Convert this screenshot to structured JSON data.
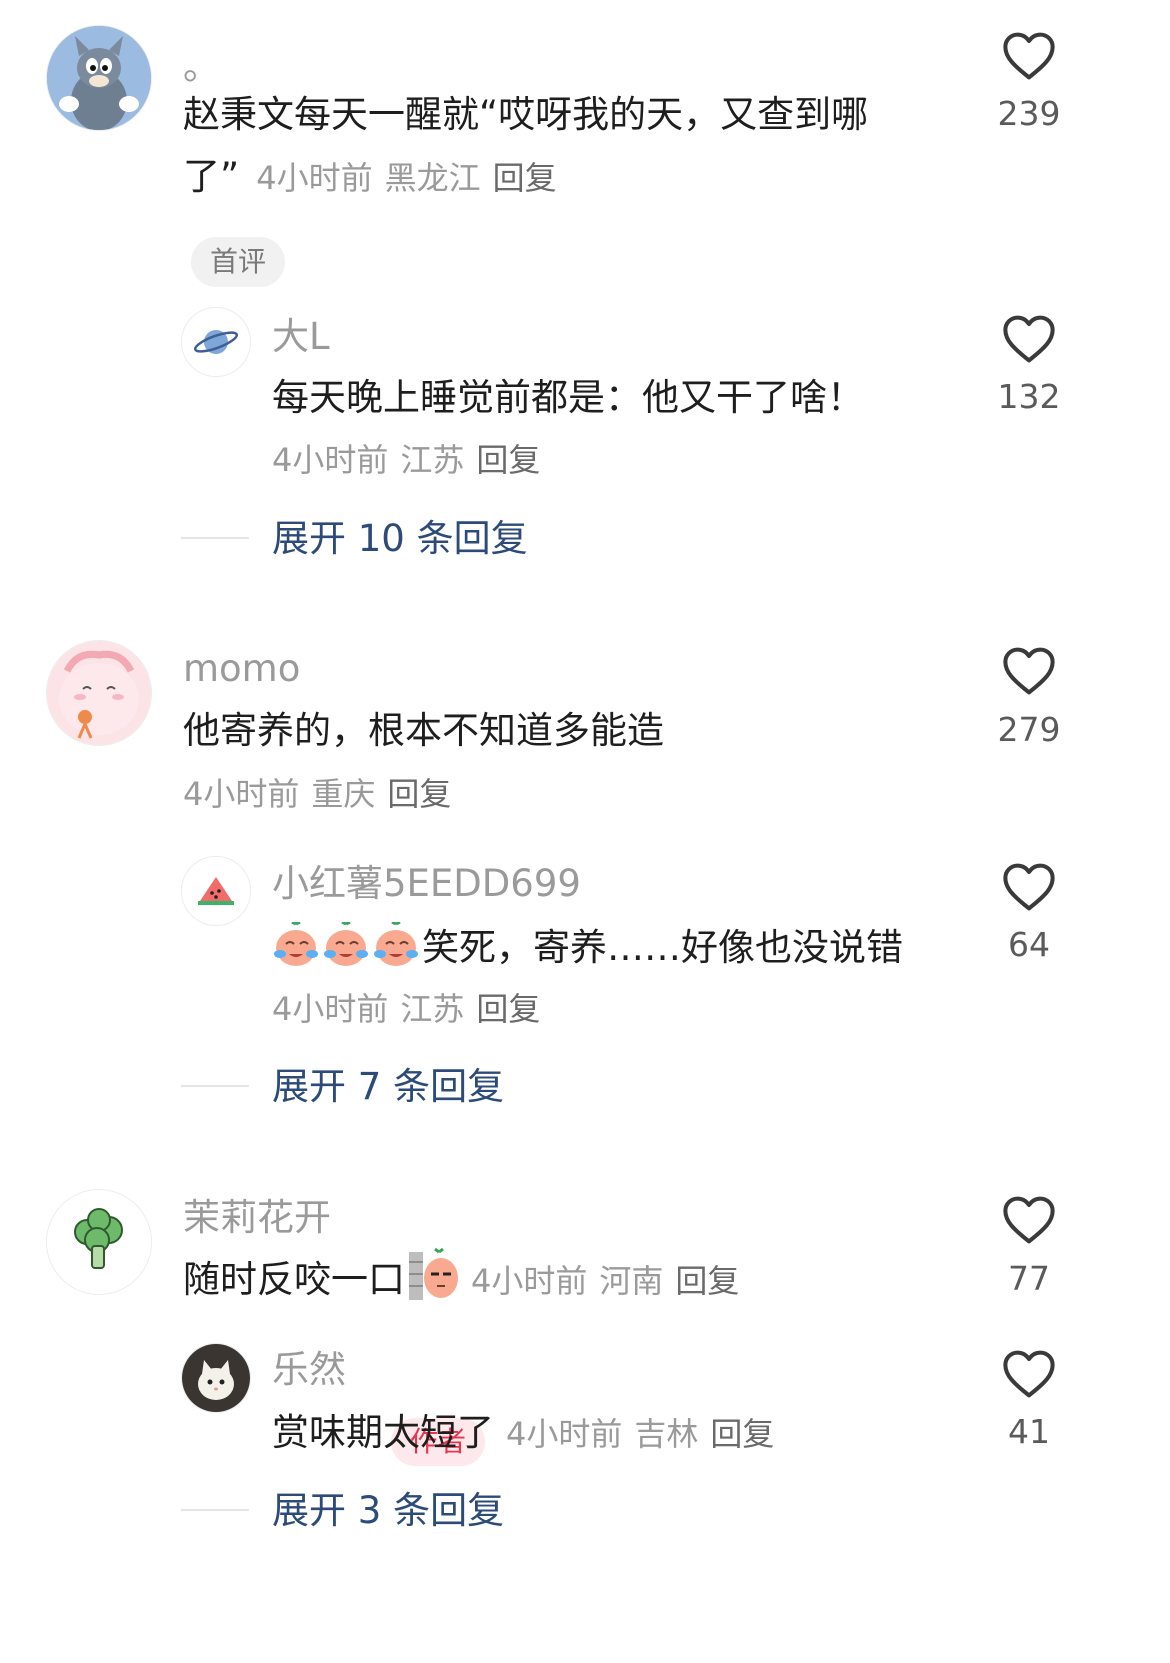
{
  "comments": [
    {
      "username": "。",
      "text_line1": "赵秉文每天一醒就“哎呀我的天，又查到哪",
      "text_line2": "了”",
      "time": "4小时前",
      "location": "黑龙江",
      "reply_label": "回复",
      "badge": "首评",
      "likes": "239",
      "avatar": "cartoon-cat-avatar",
      "replies": [
        {
          "username": "大L",
          "text": "每天晚上睡觉前都是：他又干了啥！",
          "time": "4小时前",
          "location": "江苏",
          "reply_label": "回复",
          "likes": "132",
          "avatar": "planet-avatar"
        }
      ],
      "expand_label": "展开 10 条回复"
    },
    {
      "username": "momo",
      "text": "他寄养的，根本不知道多能造",
      "time": "4小时前",
      "location": "重庆",
      "reply_label": "回复",
      "likes": "279",
      "avatar": "pink-character-avatar",
      "replies": [
        {
          "username": "小红薯5EEDD699",
          "text": "笑死，寄养……好像也没说错",
          "emoji": "crying-laughing-emoji x3",
          "time": "4小时前",
          "location": "江苏",
          "reply_label": "回复",
          "likes": "64",
          "avatar": "watermelon-avatar"
        }
      ],
      "expand_label": "展开 7 条回复"
    },
    {
      "username": "茉莉花开",
      "text": "随时反咬一口",
      "emoji": "peeking-emoji",
      "time": "4小时前",
      "location": "河南",
      "reply_label": "回复",
      "likes": "77",
      "avatar": "broccoli-avatar",
      "replies": [
        {
          "username": "乐然",
          "badge": "作者",
          "text": "赏味期太短了",
          "time": "4小时前",
          "location": "吉林",
          "reply_label": "回复",
          "likes": "41",
          "avatar": "white-cat-photo-avatar"
        }
      ],
      "expand_label": "展开 3 条回复"
    }
  ],
  "colors": {
    "link": "#2c4b78",
    "meta": "#9a9a9a",
    "author_badge": "#e8344d"
  }
}
